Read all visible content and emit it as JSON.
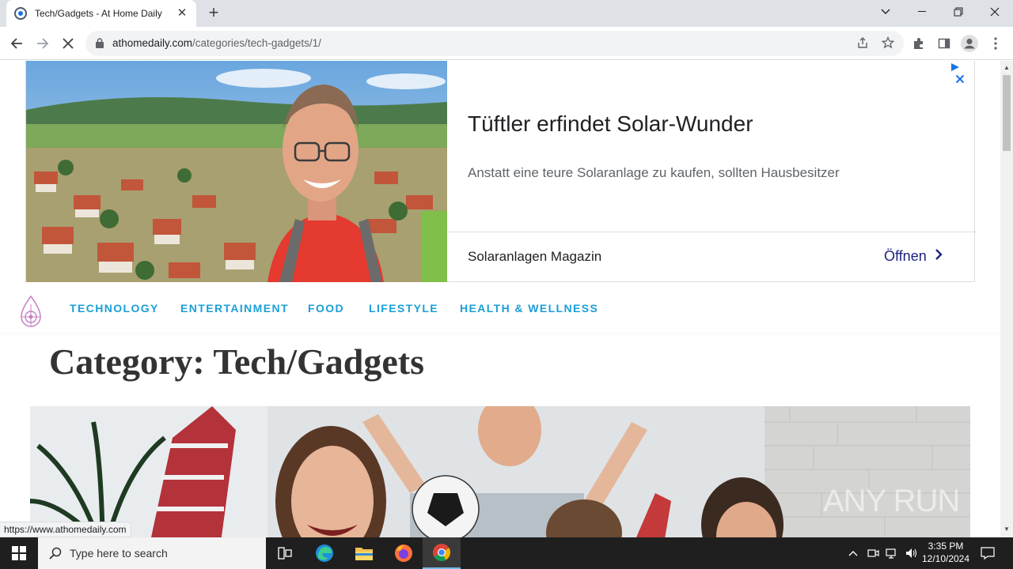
{
  "browser": {
    "tab_title": "Tech/Gadgets - At Home Daily",
    "url_domain": "athomedaily.com",
    "url_path": "/categories/tech-gadgets/1/",
    "status_url": "https://www.athomedaily.com"
  },
  "ad": {
    "headline": "Tüftler erfindet Solar-Wunder",
    "body": "Anstatt eine teure Solaranlage zu kaufen, sollten Hausbesitzer",
    "source": "Solaranlagen Magazin",
    "cta": "Öffnen"
  },
  "nav": {
    "items": [
      "TECHNOLOGY",
      "ENTERTAINMENT",
      "FOOD",
      "LIFESTYLE",
      "HEALTH & WELLNESS"
    ]
  },
  "page": {
    "category_title": "Category: Tech/Gadgets"
  },
  "watermark": "ANY RUN",
  "taskbar": {
    "search_placeholder": "Type here to search",
    "time": "3:35 PM",
    "date": "12/10/2024"
  },
  "colors": {
    "nav_link": "#1a9fd8",
    "cta": "#1a237e",
    "taskbar": "#1f1f1f"
  }
}
